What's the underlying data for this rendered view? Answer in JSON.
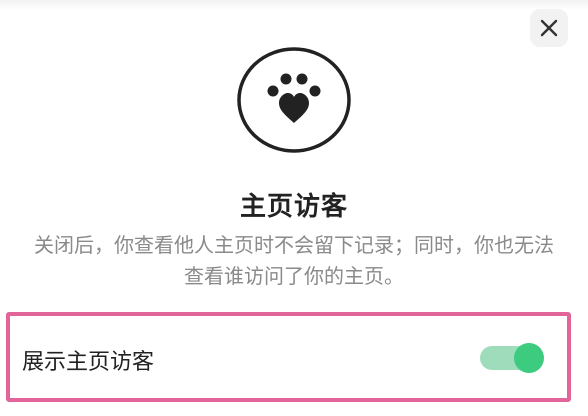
{
  "dialog": {
    "title": "主页访客",
    "description_line1": "关闭后，你查看他人主页时不会留下记录；同时，你也无法",
    "description_line2": "查看谁访问了你的主页。"
  },
  "setting": {
    "label": "展示主页访客",
    "enabled": true
  },
  "icons": {
    "close": "close-icon",
    "header": "paw-heart-icon"
  },
  "colors": {
    "toggle_on": "#3ccb7f",
    "highlight_frame": "#e2659a"
  }
}
